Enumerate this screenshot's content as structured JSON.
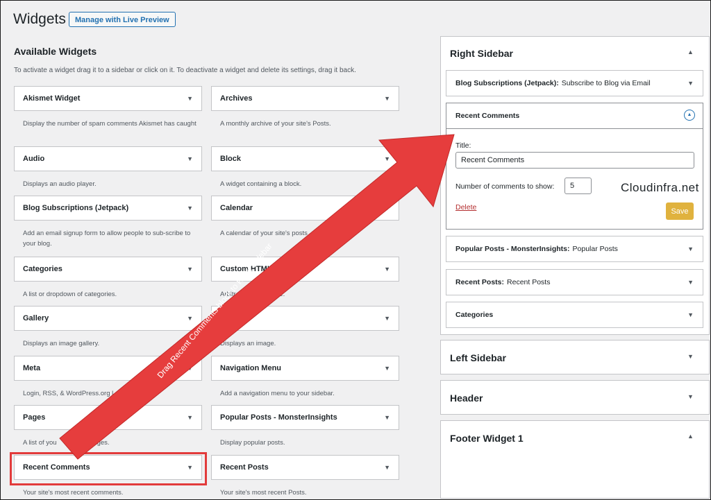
{
  "header": {
    "title": "Widgets",
    "live_preview_label": "Manage with Live Preview"
  },
  "available": {
    "title": "Available Widgets",
    "description": "To activate a widget drag it to a sidebar or click on it. To deactivate a widget and delete its settings, drag it back."
  },
  "widgets_left": [
    {
      "name": "Akismet Widget",
      "desc": "Display the number of spam comments Akismet has caught"
    },
    {
      "name": "Audio",
      "desc": "Displays an audio player."
    },
    {
      "name": "Blog Subscriptions (Jetpack)",
      "desc": "Add an email signup form to allow people to sub-scribe to your blog."
    },
    {
      "name": "Categories",
      "desc": "A list or dropdown of categories."
    },
    {
      "name": "Gallery",
      "desc": "Displays an image gallery."
    },
    {
      "name": "Meta",
      "desc": "Login, RSS, & WordPress.org l"
    },
    {
      "name": "Pages",
      "desc": "A list of you",
      "desc_tail": "pages."
    },
    {
      "name": "Recent Comments",
      "desc": "Your site's most recent comments."
    }
  ],
  "widgets_right": [
    {
      "name": "Archives",
      "desc": "A monthly archive of your site's Posts."
    },
    {
      "name": "Block",
      "desc": "A widget containing a block."
    },
    {
      "name": "Calendar",
      "desc": "A calendar of your site's posts"
    },
    {
      "name": "Custom HTML",
      "desc": "Arbitr",
      "desc_tail": "de."
    },
    {
      "name": "",
      "desc": "Displays an image."
    },
    {
      "name": "Navigation Menu",
      "desc": "Add a navigation menu to your sidebar."
    },
    {
      "name": "Popular Posts - MonsterInsights",
      "desc": "Display popular posts."
    },
    {
      "name": "Recent Posts",
      "desc": "Your site's most recent Posts."
    }
  ],
  "right_sidebar": {
    "title": "Right Sidebar",
    "items": [
      {
        "name": "Blog Subscriptions (Jetpack):",
        "subtitle": "Subscribe to Blog via Email"
      },
      {
        "name": "Popular Posts - MonsterInsights:",
        "subtitle": "Popular Posts"
      },
      {
        "name": "Recent Posts:",
        "subtitle": "Recent Posts"
      },
      {
        "name": "Categories",
        "subtitle": ""
      }
    ],
    "recent_comments": {
      "name": "Recent Comments",
      "title_label": "Title:",
      "title_value": "Recent Comments",
      "count_label": "Number of comments to show:",
      "count_value": "5",
      "delete_label": "Delete",
      "save_label": "Save"
    }
  },
  "other_sidebars": [
    "Left Sidebar",
    "Header",
    "Footer Widget 1"
  ],
  "annotation": {
    "text": "Drag Recent Comments block to Right Sidebar"
  },
  "watermark": {
    "text": "Cloudinfra.net"
  },
  "icons": {
    "collapse": "triangle-down-icon",
    "expand": "triangle-up-icon",
    "toggle": "circle-chevron-up-icon"
  },
  "colors": {
    "accent": "#2271b1",
    "arrow": "#e23b3b",
    "save": "#e0b23e",
    "delete": "#b32d2e"
  }
}
